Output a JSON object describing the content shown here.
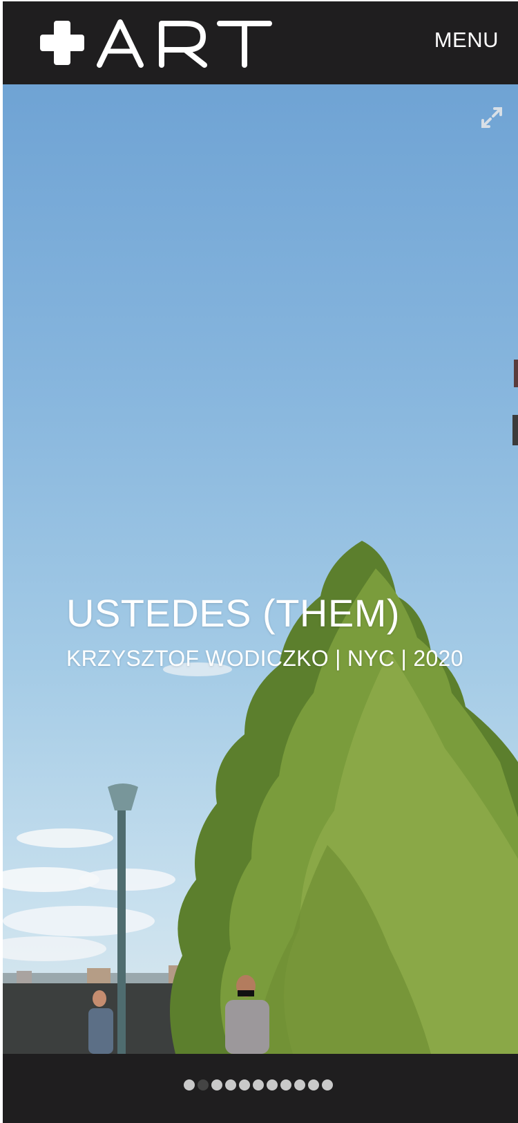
{
  "header": {
    "logo_text": "+ART",
    "menu_label": "MENU"
  },
  "hero": {
    "title": "USTEDES (THEM)",
    "subtitle": "KRZYSZTOF WODICZKO | NYC | 2020",
    "expand_icon": "expand-arrows-icon"
  },
  "carousel": {
    "total_slides": 11,
    "active_index": 1
  },
  "colors": {
    "header_bg": "#1f1e1f",
    "text": "#ffffff",
    "dot_inactive": "#c9c9c9",
    "dot_active": "#444444"
  }
}
